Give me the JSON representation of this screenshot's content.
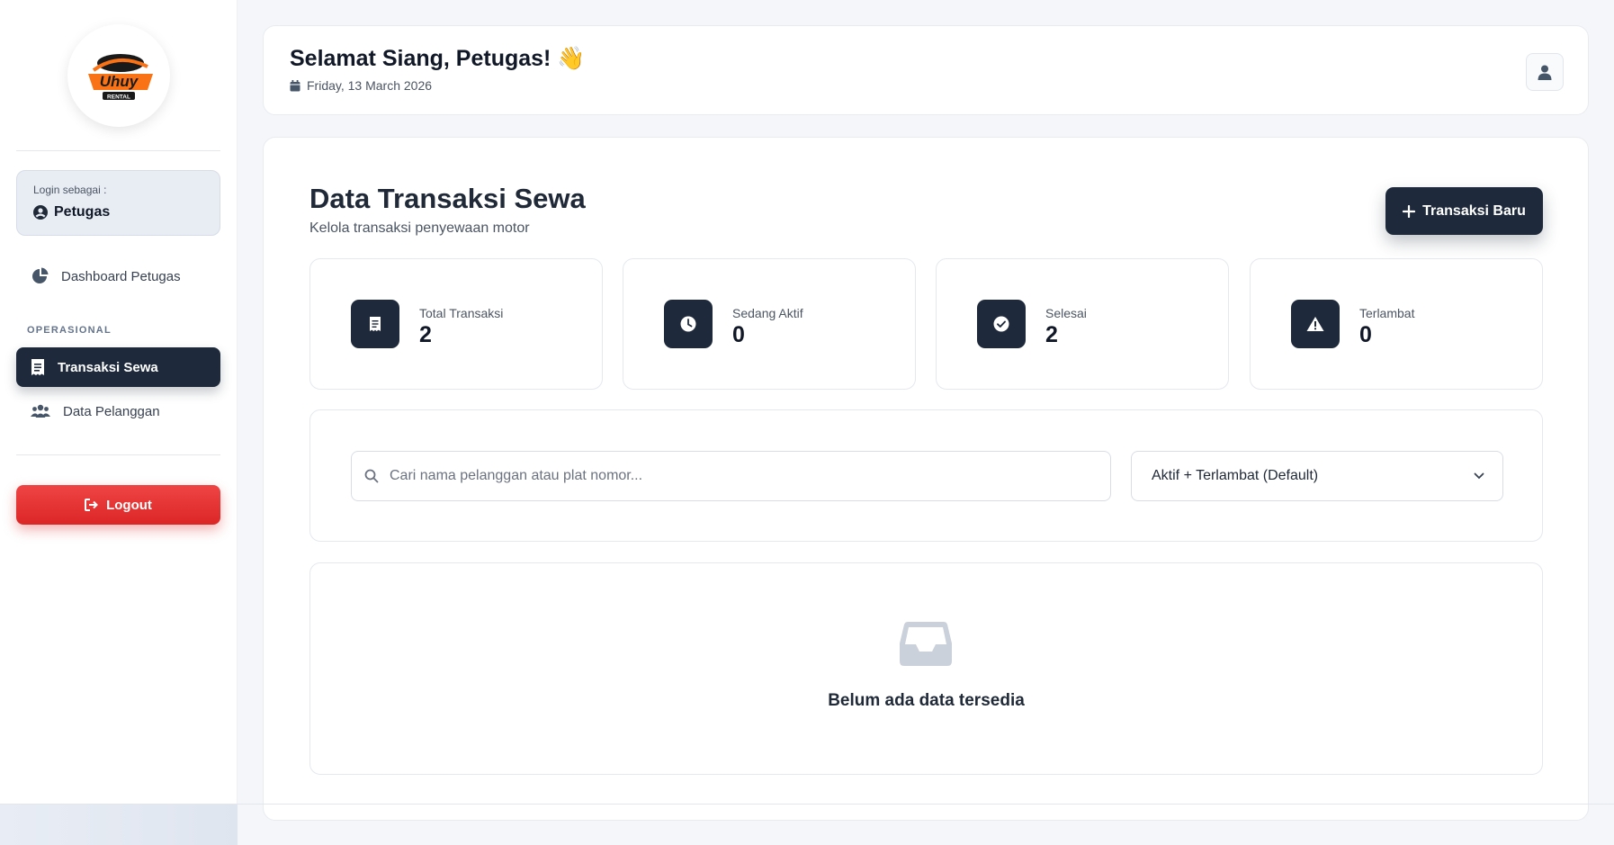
{
  "sidebar": {
    "brand": {
      "logo_top": "Uhuy",
      "logo_sub": "RENTAL"
    },
    "login": {
      "label": "Login sebagai :",
      "role": "Petugas"
    },
    "nav": [
      {
        "label": "Dashboard Petugas",
        "icon": "pie-chart-icon"
      },
      {
        "label": "Transaksi Sewa",
        "icon": "receipt-icon",
        "active": true
      },
      {
        "label": "Data Pelanggan",
        "icon": "users-icon"
      }
    ],
    "section_label": "OPERASIONAL",
    "logout_label": "Logout"
  },
  "header": {
    "greeting": "Selamat Siang, Petugas! 👋",
    "date": "Friday, 13 March 2026",
    "user_icon": "user-icon"
  },
  "main": {
    "title": "Data Transaksi Sewa",
    "subtitle": "Kelola transaksi penyewaan motor",
    "new_button": "Transaksi Baru",
    "stats": [
      {
        "label": "Total Transaksi",
        "value": "2",
        "icon": "receipt-icon"
      },
      {
        "label": "Sedang Aktif",
        "value": "0",
        "icon": "clock-icon"
      },
      {
        "label": "Selesai",
        "value": "2",
        "icon": "check-circle-icon"
      },
      {
        "label": "Terlambat",
        "value": "0",
        "icon": "warning-icon"
      }
    ],
    "search": {
      "placeholder": "Cari nama pelanggan atau plat nomor...",
      "value": ""
    },
    "filter": {
      "selected": "Aktif + Terlambat (Default)"
    },
    "empty_text": "Belum ada data tersedia"
  },
  "colors": {
    "primary": "#1e2a3b",
    "danger": "#ef4444",
    "background": "#f4f6f9"
  }
}
